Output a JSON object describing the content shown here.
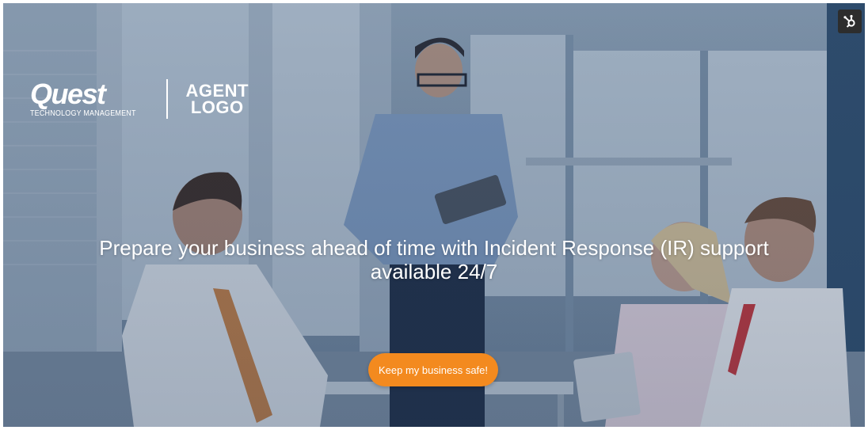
{
  "brand": {
    "quest_word": "Quest",
    "quest_tagline": "TECHNOLOGY MANAGEMENT",
    "agent_logo_line1": "AGENT",
    "agent_logo_line2": "LOGO"
  },
  "hero": {
    "headline_line1": "Prepare your business ahead of time with Incident Response (IR) support",
    "headline_line2": "available 24/7",
    "cta_label": "Keep my business safe!"
  },
  "badge": {
    "icon": "hubspot-sprocket-icon"
  },
  "colors": {
    "cta": "#f38a1f",
    "text": "#ffffff",
    "badge_bg": "#2d2d2d",
    "overlay": "#2a4262"
  }
}
